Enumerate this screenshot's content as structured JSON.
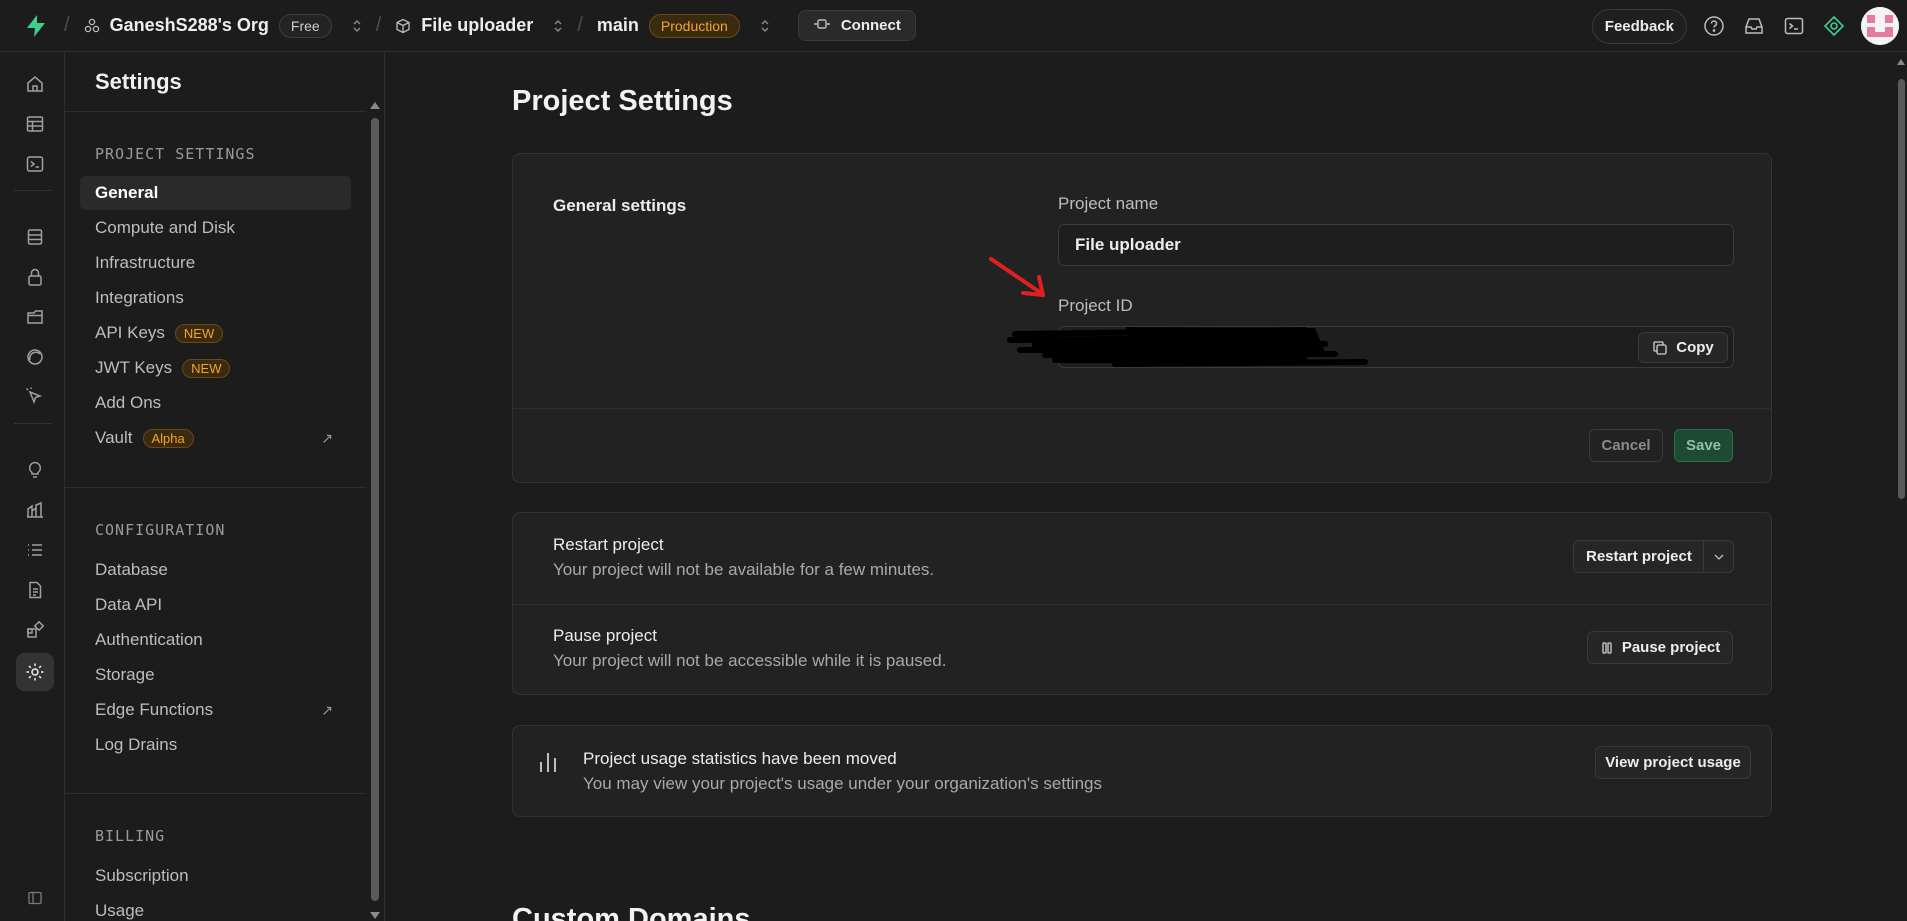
{
  "topbar": {
    "org_name": "GaneshS288's Org",
    "org_plan": "Free",
    "project_name": "File uploader",
    "branch": "main",
    "branch_env": "Production",
    "connect_label": "Connect",
    "feedback_label": "Feedback"
  },
  "sidebar": {
    "title": "Settings",
    "project_settings_label": "PROJECT SETTINGS",
    "project_items": [
      {
        "label": "General"
      },
      {
        "label": "Compute and Disk"
      },
      {
        "label": "Infrastructure"
      },
      {
        "label": "Integrations"
      },
      {
        "label": "API Keys",
        "badge": "NEW"
      },
      {
        "label": "JWT Keys",
        "badge": "NEW"
      },
      {
        "label": "Add Ons"
      },
      {
        "label": "Vault",
        "badge": "Alpha"
      }
    ],
    "configuration_label": "CONFIGURATION",
    "configuration_items": [
      {
        "label": "Database"
      },
      {
        "label": "Data API"
      },
      {
        "label": "Authentication"
      },
      {
        "label": "Storage"
      },
      {
        "label": "Edge Functions"
      },
      {
        "label": "Log Drains"
      }
    ],
    "billing_label": "BILLING",
    "billing_items": [
      {
        "label": "Subscription"
      },
      {
        "label": "Usage"
      }
    ]
  },
  "main": {
    "page_title": "Project Settings",
    "general": {
      "heading": "General settings",
      "project_name_label": "Project name",
      "project_name_value": "File uploader",
      "project_id_label": "Project ID",
      "copy_label": "Copy",
      "cancel_label": "Cancel",
      "save_label": "Save"
    },
    "restart": {
      "title": "Restart project",
      "description": "Your project will not be available for a few minutes.",
      "button": "Restart project"
    },
    "pause": {
      "title": "Pause project",
      "description": "Your project will not be accessible while it is paused.",
      "button": "Pause project"
    },
    "usage": {
      "title": "Project usage statistics have been moved",
      "description": "You may view your project's usage under your organization's settings",
      "button": "View project usage"
    },
    "next_section_title": "Custom Domains"
  },
  "colors": {
    "accent_green": "#3ecf8e",
    "annotation_red": "#e02020",
    "badge_orange": "#f5a623"
  }
}
